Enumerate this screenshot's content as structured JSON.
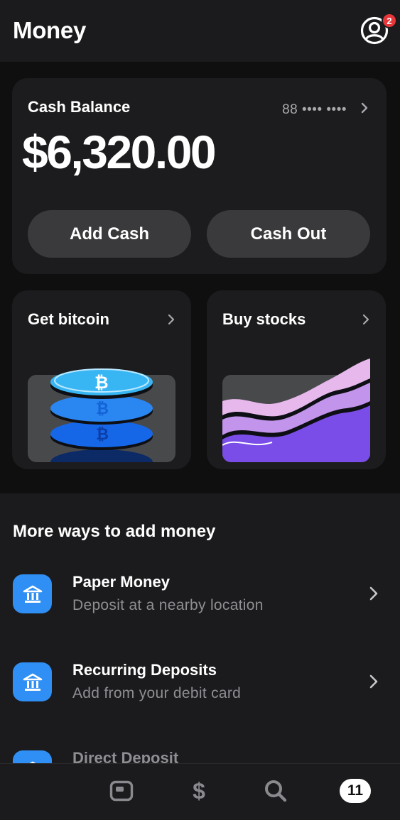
{
  "header": {
    "title": "Money",
    "profile_badge": "2"
  },
  "balance": {
    "label": "Cash Balance",
    "account_masked": "88 •••• ••••",
    "amount": "$6,320.00",
    "add_cash_label": "Add Cash",
    "cash_out_label": "Cash Out"
  },
  "tiles": {
    "bitcoin_title": "Get bitcoin",
    "stocks_title": "Buy stocks"
  },
  "more_ways": {
    "title": "More ways to add money",
    "items": [
      {
        "title": "Paper Money",
        "subtitle": "Deposit at a nearby location",
        "icon": "bank-icon"
      },
      {
        "title": "Recurring Deposits",
        "subtitle": "Add from your debit card",
        "icon": "bank-icon"
      },
      {
        "title": "Direct Deposit",
        "subtitle": "",
        "icon": "bank-icon"
      }
    ]
  },
  "tabbar": {
    "home_icon": "home-icon",
    "money_icon": "dollar-icon",
    "money_glyph": "$",
    "search_icon": "search-icon",
    "activity_count": "11"
  },
  "colors": {
    "accent_blue": "#2f8ff4",
    "badge_red": "#e8373b",
    "card_bg": "#1c1c1e",
    "button_bg": "#3a3a3c"
  }
}
